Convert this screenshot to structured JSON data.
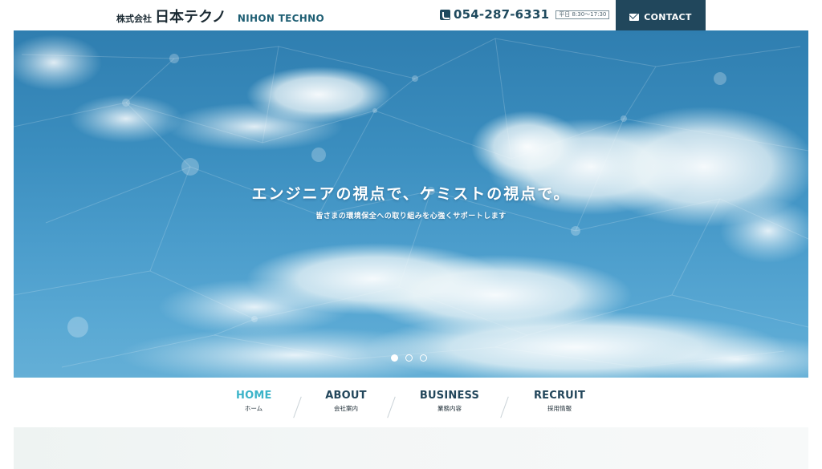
{
  "header": {
    "logo_prefix": "株式会社",
    "logo_name": "日本テクノ",
    "logo_en": "NIHON TECHNO",
    "phone": "054-287-6331",
    "hours": "平日 8:30〜17:30",
    "contact_label": "CONTACT",
    "phone_icon": "phone-icon",
    "contact_icon": "mail-icon"
  },
  "hero": {
    "title": "エンジニアの視点で、ケミストの視点で。",
    "subtitle": "皆さまの環境保全への取り組みを心強くサポートします",
    "slides": [
      {
        "active": true
      },
      {
        "active": false
      },
      {
        "active": false
      }
    ]
  },
  "nav": {
    "items": [
      {
        "en": "HOME",
        "jp": "ホーム",
        "active": true
      },
      {
        "en": "ABOUT",
        "jp": "会社案内",
        "active": false
      },
      {
        "en": "BUSINESS",
        "jp": "業務内容",
        "active": false
      },
      {
        "en": "RECRUIT",
        "jp": "採用情報",
        "active": false
      }
    ]
  },
  "colors": {
    "brand_dark": "#21475c",
    "accent": "#3cb4c9",
    "sky": "#3b8ebf"
  }
}
